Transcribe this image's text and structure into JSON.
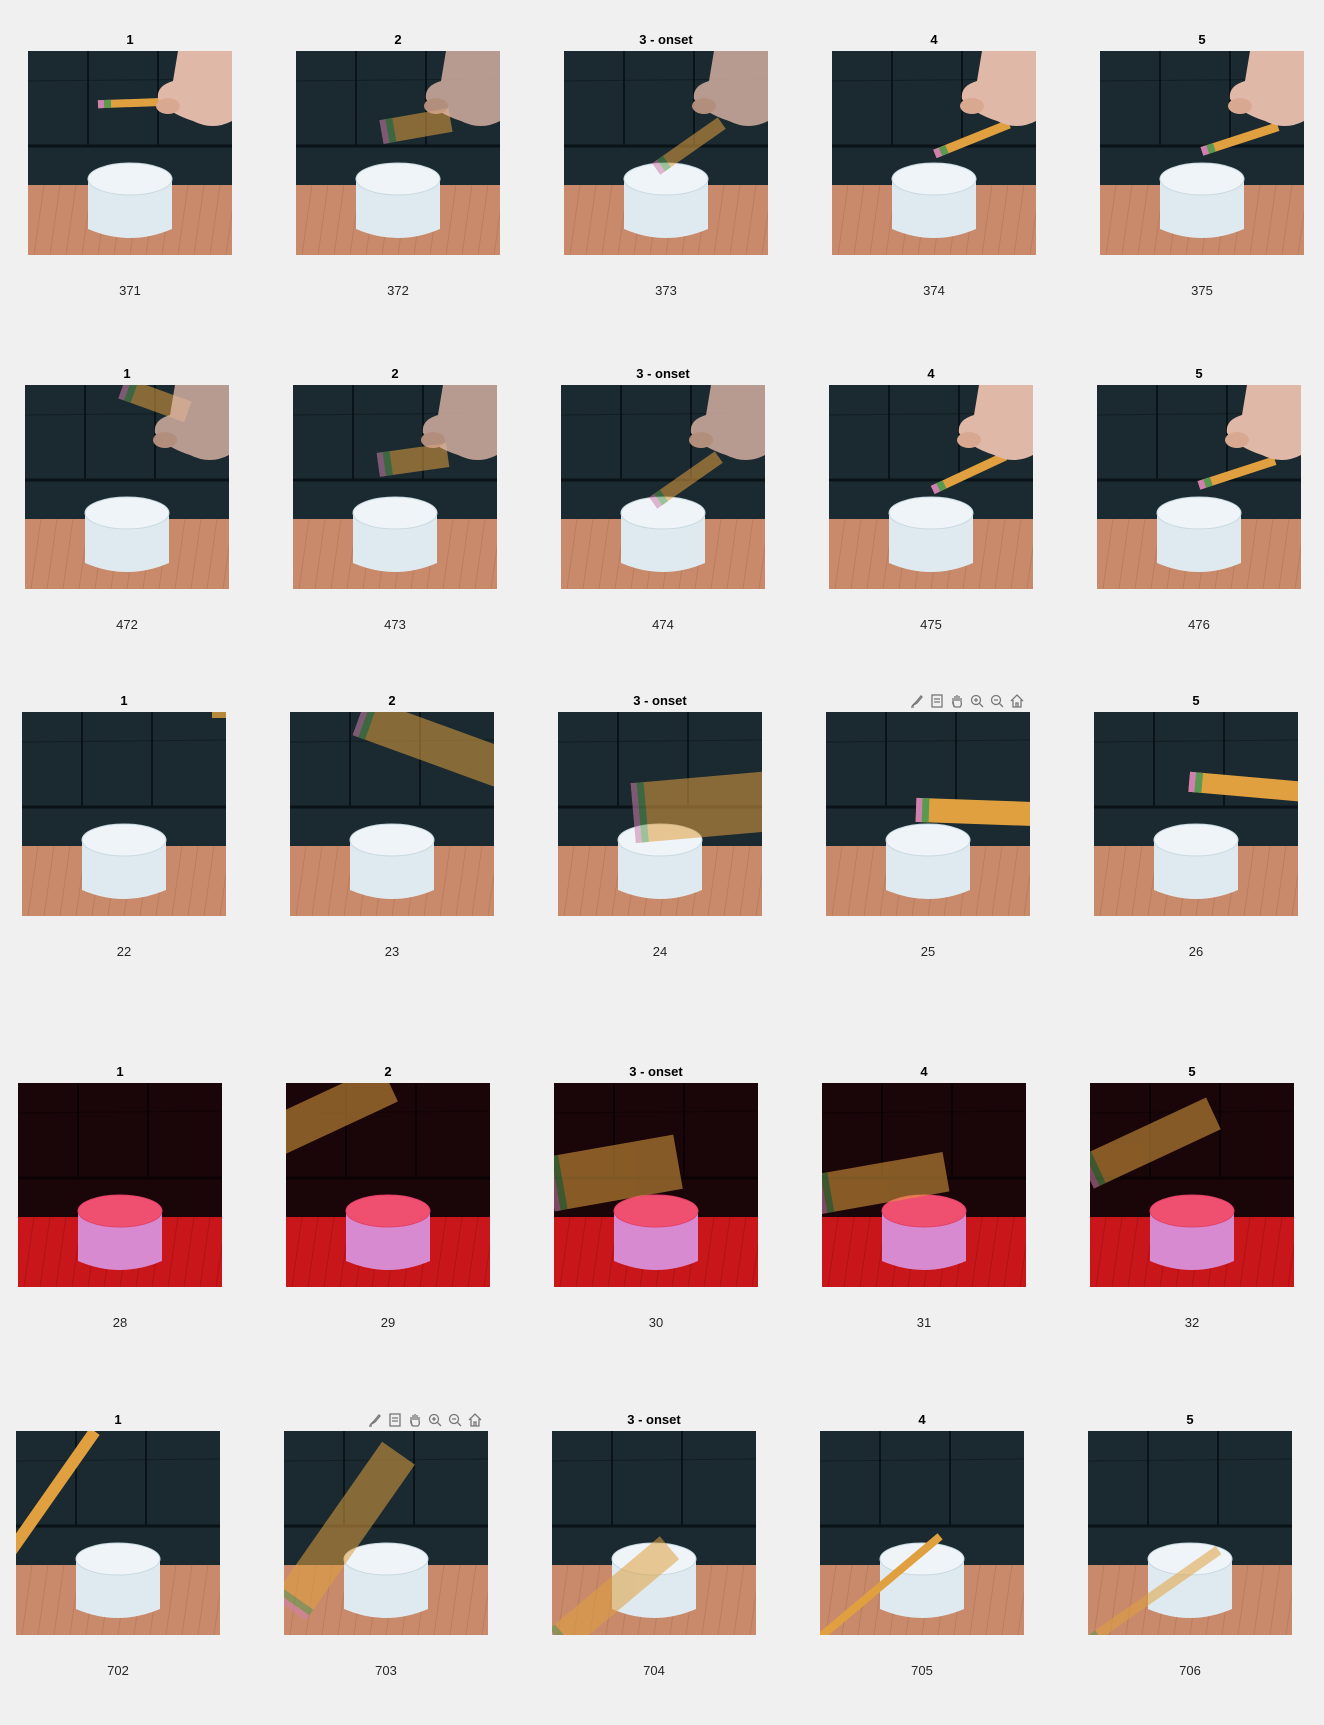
{
  "colors": {
    "background": "#f0f0f0",
    "couch": "#1a2a30",
    "couch_seam": "#0a1318",
    "table_wood": "#c88a6a",
    "table_red": "#c8161a",
    "couch_dark_red": "#1a0508",
    "puck": "#dfeaf0",
    "puck_pink_top": "#f05070",
    "puck_pink_side": "#d88ad0",
    "pencil": "#e0a040",
    "pencil_band": "#5a9a50",
    "eraser": "#d080b0",
    "hand": "#e0b8a8"
  },
  "axes_toolbar_icons": [
    "brush-icon",
    "datatip-icon",
    "pan-icon",
    "zoom-in-icon",
    "zoom-out-icon",
    "home-icon"
  ],
  "rows": [
    {
      "scene": "wood",
      "panels": [
        {
          "title": "1",
          "xlabel": "371",
          "motion": "hand-pencil-horizontal",
          "pencil_angle": -2
        },
        {
          "title": "2",
          "xlabel": "372",
          "motion": "hand-pencil-blur",
          "pencil_angle": -10
        },
        {
          "title": "3 - onset",
          "xlabel": "373",
          "motion": "hand-pencil-strike",
          "pencil_angle": -35
        },
        {
          "title": "4",
          "xlabel": "374",
          "motion": "hand-pencil-lift",
          "pencil_angle": -22
        },
        {
          "title": "5",
          "xlabel": "375",
          "motion": "hand-pencil-lift",
          "pencil_angle": -18
        }
      ]
    },
    {
      "scene": "wood",
      "panels": [
        {
          "title": "1",
          "xlabel": "472",
          "motion": "hand-pencil-blur-top",
          "pencil_angle": 20
        },
        {
          "title": "2",
          "xlabel": "473",
          "motion": "hand-pencil-blur",
          "pencil_angle": -8
        },
        {
          "title": "3 - onset",
          "xlabel": "474",
          "motion": "hand-pencil-strike",
          "pencil_angle": -35
        },
        {
          "title": "4",
          "xlabel": "475",
          "motion": "hand-pencil-lift",
          "pencil_angle": -25
        },
        {
          "title": "5",
          "xlabel": "476",
          "motion": "hand-pencil-lift",
          "pencil_angle": -18
        }
      ]
    },
    {
      "scene": "wood-light",
      "panels": [
        {
          "title": "1",
          "xlabel": "22",
          "motion": "pencil-none",
          "pencil_angle": 0
        },
        {
          "title": "2",
          "xlabel": "23",
          "motion": "pencil-blur-top",
          "pencil_angle": 20
        },
        {
          "title": "3 - onset",
          "xlabel": "24",
          "motion": "pencil-strike",
          "pencil_angle": -5
        },
        {
          "title": "",
          "xlabel": "25",
          "motion": "pencil-right",
          "pencil_angle": 2,
          "toolbar": true
        },
        {
          "title": "5",
          "xlabel": "26",
          "motion": "pencil-right-high",
          "pencil_angle": 5
        }
      ]
    },
    {
      "scene": "red",
      "panels": [
        {
          "title": "1",
          "xlabel": "28",
          "motion": "pencil-none",
          "pencil_angle": 0
        },
        {
          "title": "2",
          "xlabel": "29",
          "motion": "pencil-left-blur",
          "pencil_angle": -25
        },
        {
          "title": "3 - onset",
          "xlabel": "30",
          "motion": "pencil-left-strike",
          "pencil_angle": -10
        },
        {
          "title": "4",
          "xlabel": "31",
          "motion": "pencil-left-mid",
          "pencil_angle": -10
        },
        {
          "title": "5",
          "xlabel": "32",
          "motion": "pencil-left-high",
          "pencil_angle": -25
        }
      ]
    },
    {
      "scene": "wood-blue",
      "panels": [
        {
          "title": "1",
          "xlabel": "702",
          "motion": "pencil-diag-left",
          "pencil_angle": -55
        },
        {
          "title": "",
          "xlabel": "703",
          "motion": "pencil-diag-blur",
          "pencil_angle": -55,
          "toolbar": true
        },
        {
          "title": "3 - onset",
          "xlabel": "704",
          "motion": "pencil-diag-strike",
          "pencil_angle": -40
        },
        {
          "title": "4",
          "xlabel": "705",
          "motion": "pencil-diag-low",
          "pencil_angle": -40
        },
        {
          "title": "5",
          "xlabel": "706",
          "motion": "pencil-diag-low2",
          "pencil_angle": -35
        }
      ]
    }
  ]
}
